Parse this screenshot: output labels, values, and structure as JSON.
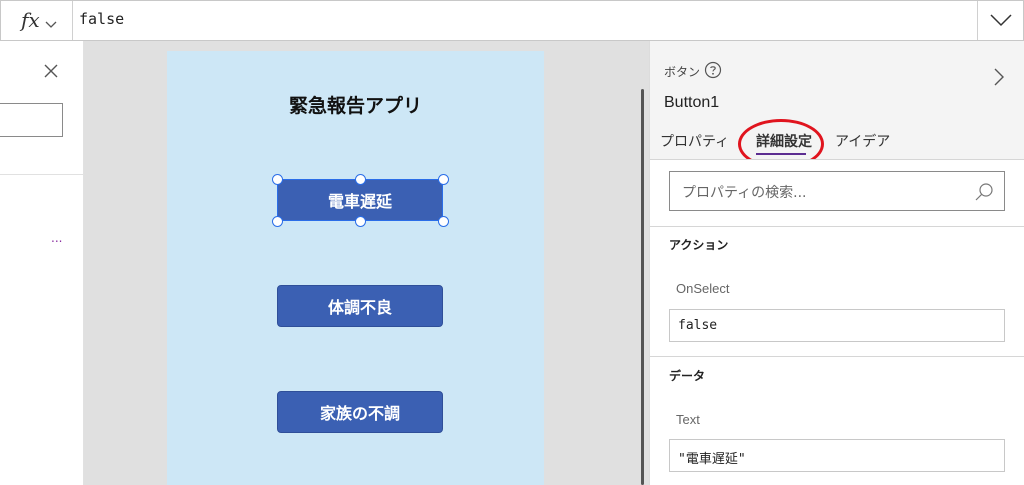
{
  "formula_bar": {
    "fx_label": "fx",
    "value": "false"
  },
  "canvas": {
    "app_title": "緊急報告アプリ",
    "buttons": [
      {
        "label": "電車遅延",
        "selected": true
      },
      {
        "label": "体調不良",
        "selected": false
      },
      {
        "label": "家族の不調",
        "selected": false
      }
    ],
    "colors": {
      "screen_bg": "#cde7f6",
      "button_bg": "#3b60b3",
      "selection": "#2b6ee8"
    }
  },
  "left_panel": {
    "more_label": "..."
  },
  "properties": {
    "control_type": "ボタン",
    "control_name": "Button1",
    "tabs": [
      {
        "label": "プロパティ",
        "active": false
      },
      {
        "label": "詳細設定",
        "active": true
      },
      {
        "label": "アイデア",
        "active": false
      }
    ],
    "search_placeholder": "プロパティの検索...",
    "sections": [
      {
        "title": "アクション",
        "property": "OnSelect",
        "value": "false"
      },
      {
        "title": "データ",
        "property": "Text",
        "value": "\"電車遅延\""
      }
    ],
    "highlight_color": "#e0141e"
  }
}
